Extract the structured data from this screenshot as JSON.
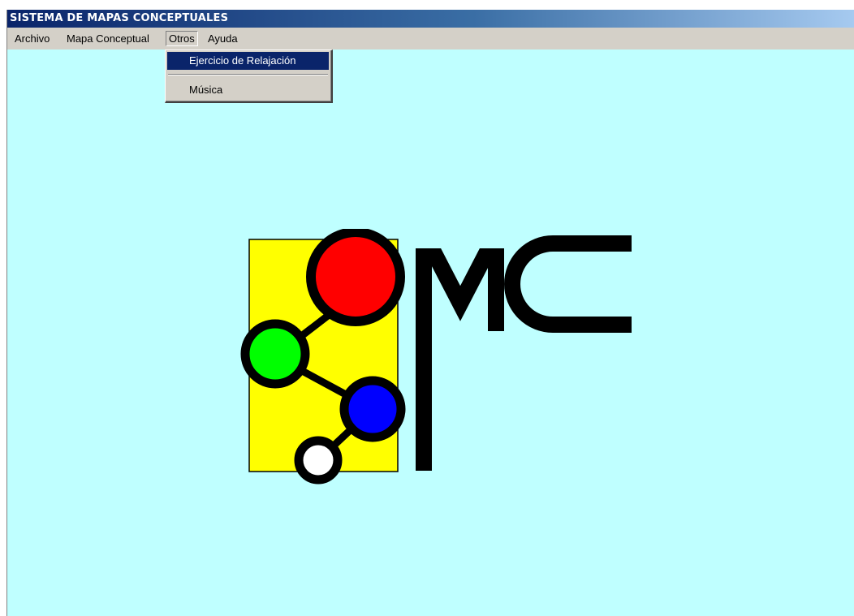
{
  "window": {
    "title": "SISTEMA DE MAPAS CONCEPTUALES",
    "background_color": "#bfffff"
  },
  "menubar": {
    "items": [
      {
        "label": "Archivo"
      },
      {
        "label": "Mapa Conceptual"
      },
      {
        "label": "Otros",
        "open": true
      },
      {
        "label": "Ayuda"
      }
    ]
  },
  "dropdown": {
    "menu": "Otros",
    "items": [
      {
        "label": "Ejercicio de Relajación",
        "selected": true
      },
      {
        "label": "Música",
        "selected": false
      }
    ]
  },
  "logo": {
    "text": "MC",
    "colors": {
      "panel": "#ffff00",
      "node_top": "#ff0000",
      "node_left": "#00ff00",
      "node_right": "#0000ff",
      "node_bottom": "#ffffff",
      "outline": "#000000"
    }
  }
}
